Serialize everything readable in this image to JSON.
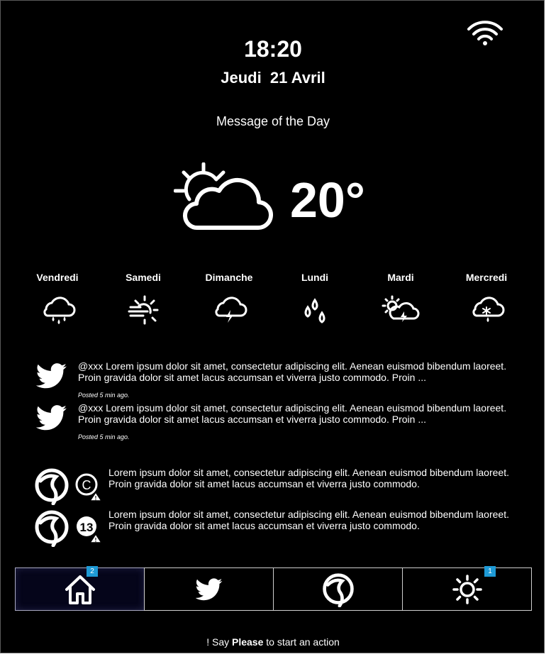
{
  "clock": {
    "time": "18:20",
    "date": "Jeudi  21 Avril"
  },
  "motd": "Message of the Day",
  "status": {
    "wifi_icon": "wifi-icon"
  },
  "current_weather": {
    "icon": "partly-cloudy-icon",
    "temperature": "20°"
  },
  "forecast": [
    {
      "day": "Vendredi",
      "icon": "cloud-rain-icon"
    },
    {
      "day": "Samedi",
      "icon": "sun-fog-icon"
    },
    {
      "day": "Dimanche",
      "icon": "cloud-lightning-icon"
    },
    {
      "day": "Lundi",
      "icon": "rain-drops-icon"
    },
    {
      "day": "Mardi",
      "icon": "sun-cloud-lightning-icon"
    },
    {
      "day": "Mercredi",
      "icon": "cloud-snow-icon"
    }
  ],
  "tweets": [
    {
      "text": "@xxx Lorem ipsum dolor sit amet, consectetur adipiscing elit. Aenean euismod bibendum laoreet. Proin gravida dolor sit amet lacus accumsan et viverra justo commodo. Proin ...",
      "posted": "Posted 5 min ago."
    },
    {
      "text": "@xxx Lorem ipsum dolor sit amet, consectetur adipiscing elit. Aenean euismod bibendum laoreet. Proin gravida dolor sit amet lacus accumsan et viverra justo commodo. Proin ...",
      "posted": "Posted 5 min ago."
    }
  ],
  "transit": [
    {
      "line": "C",
      "text": "Lorem ipsum dolor sit amet, consectetur adipiscing elit. Aenean euismod bibendum laoreet. Proin gravida dolor sit amet lacus accumsan et viverra justo commodo."
    },
    {
      "line": "13",
      "text": "Lorem ipsum dolor sit amet, consectetur adipiscing elit. Aenean euismod bibendum laoreet. Proin gravida dolor sit amet lacus accumsan et viverra justo commodo."
    }
  ],
  "nav": {
    "home_badge": "2",
    "settings_badge": "1",
    "icons": [
      "home-icon",
      "twitter-icon",
      "transit-logo-icon",
      "sun-icon"
    ]
  },
  "hint": {
    "prefix": "! Say ",
    "keyword": "Please",
    "suffix": " to start an action"
  },
  "colors": {
    "background": "#000000",
    "text": "#ffffff",
    "badge": "#1e9ad6"
  }
}
